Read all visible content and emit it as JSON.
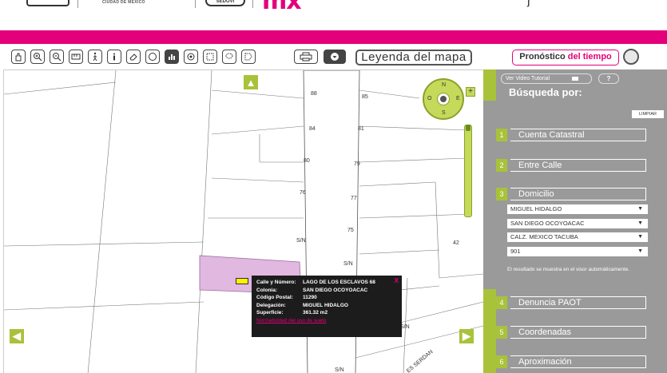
{
  "header": {
    "gov_text": "CIUDAD DE MÉXICO",
    "agency": "SEDOVI",
    "brand_prefix": "m",
    "brand_suffix": "x"
  },
  "toolbar": {
    "tools": [
      "pan-icon",
      "zoom-in-icon",
      "zoom-out-icon",
      "ruler-icon",
      "pedestrian-icon",
      "info-icon",
      "eraser-icon",
      "polygon-icon",
      "chart-icon",
      "buffer-icon",
      "select-rect-icon",
      "select-lasso-icon",
      "select-poly-icon",
      "print-icon",
      "download-icon"
    ],
    "legend_label": "Leyenda del mapa",
    "forecast_label_1": "Pronóstico",
    "forecast_label_2": "del tiempo"
  },
  "map": {
    "lot_numbers": [
      {
        "t": "88"
      },
      {
        "t": "85"
      },
      {
        "t": "84"
      },
      {
        "t": "81"
      },
      {
        "t": "80"
      },
      {
        "t": "79"
      },
      {
        "t": "76"
      },
      {
        "t": "77"
      },
      {
        "t": "S/N"
      },
      {
        "t": "75"
      },
      {
        "t": "S/N"
      },
      {
        "t": "42"
      },
      {
        "t": "S/N"
      },
      {
        "t": "S/N"
      }
    ],
    "street_name": "ES SERDAN",
    "compass": {
      "n": "N",
      "s": "S",
      "e": "E",
      "o": "O"
    },
    "popup": {
      "rows": [
        {
          "k": "Calle y Número:",
          "v": "LAGO DE LOS ESCLAVOS 68"
        },
        {
          "k": "Colonia:",
          "v": "SAN DIEGO OCOYOACAC"
        },
        {
          "k": "Código Postal:",
          "v": "11290"
        },
        {
          "k": "Delegación:",
          "v": "MIGUEL HIDALGO"
        },
        {
          "k": "Superficie:",
          "v": "361.32 m2"
        }
      ],
      "link": "Normatividad del uso de suelo",
      "close": "X"
    }
  },
  "panel": {
    "video_label": "Ver Video Tutorial",
    "help_label": "?",
    "title": "Búsqueda por:",
    "clear_label": "LIMPIAR",
    "sections": [
      {
        "num": "1",
        "label": "Cuenta Catastral"
      },
      {
        "num": "2",
        "label": "Entre Calle"
      },
      {
        "num": "3",
        "label": "Domicilio"
      },
      {
        "num": "4",
        "label": "Denuncia PAOT"
      },
      {
        "num": "5",
        "label": "Coordenadas"
      },
      {
        "num": "6",
        "label": "Aproximación"
      }
    ],
    "selects": [
      "MIGUEL HIDALGO",
      "SAN DIEGO OCOYOACAC",
      "CALZ. MEXICO TACUBA",
      "901"
    ],
    "note": "El resultado se muestra en el visor automáticamente."
  },
  "colors": {
    "brand_pink": "#e3007a",
    "accent_green": "#a8c23a",
    "panel_gray": "#9a9a9a",
    "parcel_fill": "#e0b8e0",
    "marker_yellow": "#fff200"
  }
}
